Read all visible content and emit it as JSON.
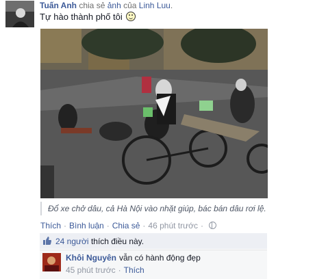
{
  "post": {
    "author": "Tuấn Anh",
    "share_text": "chia sẻ",
    "share_link": "ảnh",
    "of_text": "của",
    "owner": "Linh Luu",
    "status": "Tự hào thành phố tôi",
    "caption": "Đổ xe chở dâu, cả Hà Nội vào nhặt giúp, bác bán dâu rơi lệ.",
    "actions": {
      "like": "Thích",
      "comment": "Bình luận",
      "share": "Chia sẻ",
      "time": "46 phút trước"
    }
  },
  "likes": {
    "count_text": "24 người",
    "rest": "thích điều này."
  },
  "comment": {
    "author": "Khôi Nguyên",
    "text": "vẫn có hành động đẹp",
    "time": "45 phút trước",
    "like": "Thích"
  },
  "icons": {
    "emoticon": "smile-icon",
    "privacy": "globe-icon",
    "like": "thumbs-up-icon"
  },
  "colors": {
    "link": "#3b5998",
    "muted": "#9197a3",
    "likes_bg": "#edeff4"
  }
}
